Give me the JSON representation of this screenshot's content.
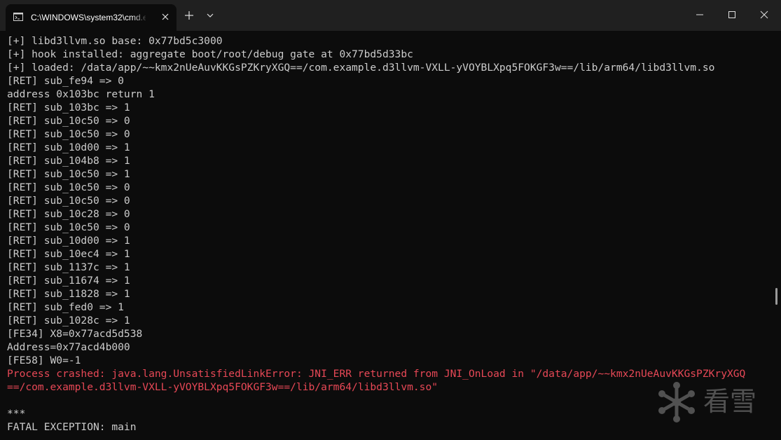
{
  "window": {
    "tab_title": "C:\\WINDOWS\\system32\\cmd.e",
    "colors": {
      "background": "#0c0c0c",
      "titlebar": "#202020",
      "text": "#cccccc",
      "error": "#e74856"
    },
    "icons": [
      "console-icon",
      "close-icon",
      "plus-icon",
      "chevron-down-icon",
      "minimize-icon",
      "maximize-icon",
      "close-icon"
    ]
  },
  "console": {
    "lines": [
      {
        "text": "[+] libd3llvm.so base: 0x77bd5c3000",
        "kind": "normal"
      },
      {
        "text": "[+] hook installed: aggregate boot/root/debug gate at 0x77bd5d33bc",
        "kind": "normal"
      },
      {
        "text": "[+] loaded: /data/app/~~kmx2nUeAuvKKGsPZKryXGQ==/com.example.d3llvm-VXLL-yVOYBLXpq5FOKGF3w==/lib/arm64/libd3llvm.so",
        "kind": "normal"
      },
      {
        "text": "[RET] sub_fe94 => 0",
        "kind": "normal"
      },
      {
        "text": "address 0x103bc return 1",
        "kind": "normal"
      },
      {
        "text": "[RET] sub_103bc => 1",
        "kind": "normal"
      },
      {
        "text": "[RET] sub_10c50 => 0",
        "kind": "normal"
      },
      {
        "text": "[RET] sub_10c50 => 0",
        "kind": "normal"
      },
      {
        "text": "[RET] sub_10d00 => 1",
        "kind": "normal"
      },
      {
        "text": "[RET] sub_104b8 => 1",
        "kind": "normal"
      },
      {
        "text": "[RET] sub_10c50 => 1",
        "kind": "normal"
      },
      {
        "text": "[RET] sub_10c50 => 0",
        "kind": "normal"
      },
      {
        "text": "[RET] sub_10c50 => 0",
        "kind": "normal"
      },
      {
        "text": "[RET] sub_10c28 => 0",
        "kind": "normal"
      },
      {
        "text": "[RET] sub_10c50 => 0",
        "kind": "normal"
      },
      {
        "text": "[RET] sub_10d00 => 1",
        "kind": "normal"
      },
      {
        "text": "[RET] sub_10ec4 => 1",
        "kind": "normal"
      },
      {
        "text": "[RET] sub_1137c => 1",
        "kind": "normal"
      },
      {
        "text": "[RET] sub_11674 => 1",
        "kind": "normal"
      },
      {
        "text": "[RET] sub_11828 => 1",
        "kind": "normal"
      },
      {
        "text": "[RET] sub_fed0 => 1",
        "kind": "normal"
      },
      {
        "text": "[RET] sub_1028c => 1",
        "kind": "normal"
      },
      {
        "text": "[FE34] X8=0x77acd5d538",
        "kind": "normal"
      },
      {
        "text": "Address=0x77acd4b000",
        "kind": "normal"
      },
      {
        "text": "[FE58] W0=-1",
        "kind": "normal"
      },
      {
        "text": "Process crashed: java.lang.UnsatisfiedLinkError: JNI_ERR returned from JNI_OnLoad in \"/data/app/~~kmx2nUeAuvKKGsPZKryXGQ",
        "kind": "error"
      },
      {
        "text": "==/com.example.d3llvm-VXLL-yVOYBLXpq5FOKGF3w==/lib/arm64/libd3llvm.so\"",
        "kind": "error"
      },
      {
        "text": "",
        "kind": "normal"
      },
      {
        "text": "***",
        "kind": "normal"
      },
      {
        "text": "FATAL EXCEPTION: main",
        "kind": "normal"
      }
    ]
  },
  "watermark": {
    "icon": "snowflake-icon",
    "text": "看雪"
  }
}
